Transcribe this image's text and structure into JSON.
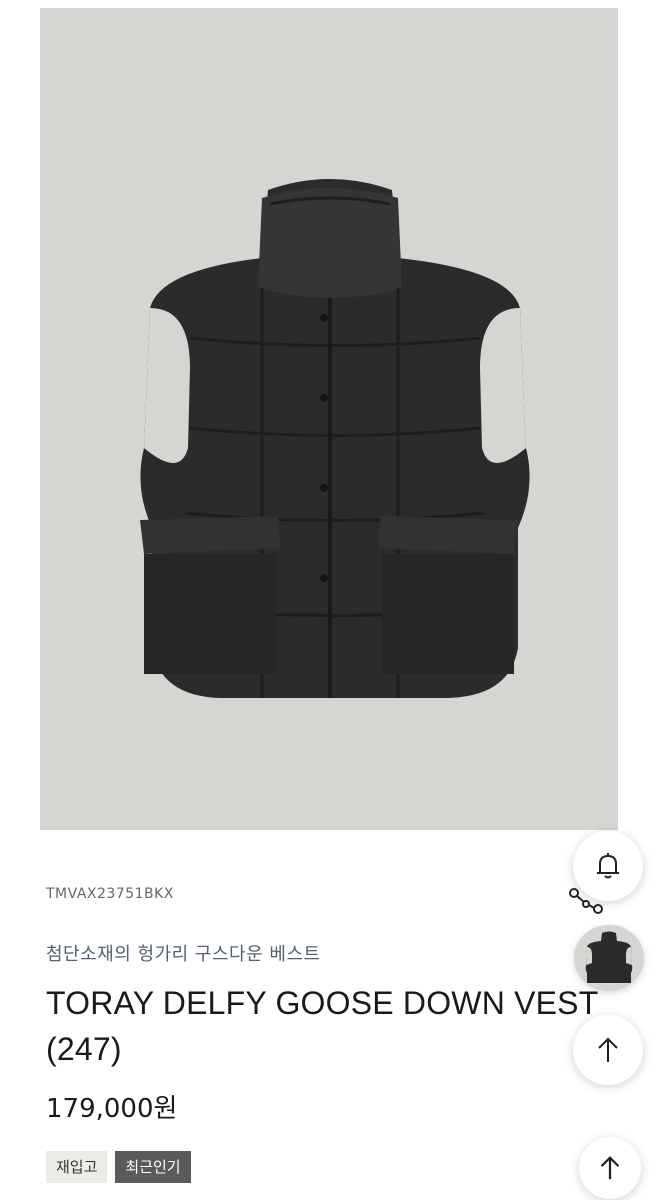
{
  "product": {
    "image_icon": "vest-photo",
    "code": "TMVAX23751BKX",
    "subtitle": "첨단소재의 헝가리 구스다운 베스트",
    "title": "TORAY DELFY GOOSE DOWN VEST (247)",
    "price": "179,000원",
    "badges": {
      "restock": "재입고",
      "popular": "최근인기"
    }
  },
  "floating_actions": {
    "notify_icon": "bell-icon",
    "share_icon": "share-icon",
    "recent_icon": "recent-product-thumbnail",
    "scroll_top_icon": "arrow-up-icon"
  },
  "colors": {
    "image_background": "#d6d5d2",
    "vest": "#2b2b2d",
    "badge_popular_bg": "#5a5a5a",
    "badge_restock_bg": "#ecebe8"
  }
}
